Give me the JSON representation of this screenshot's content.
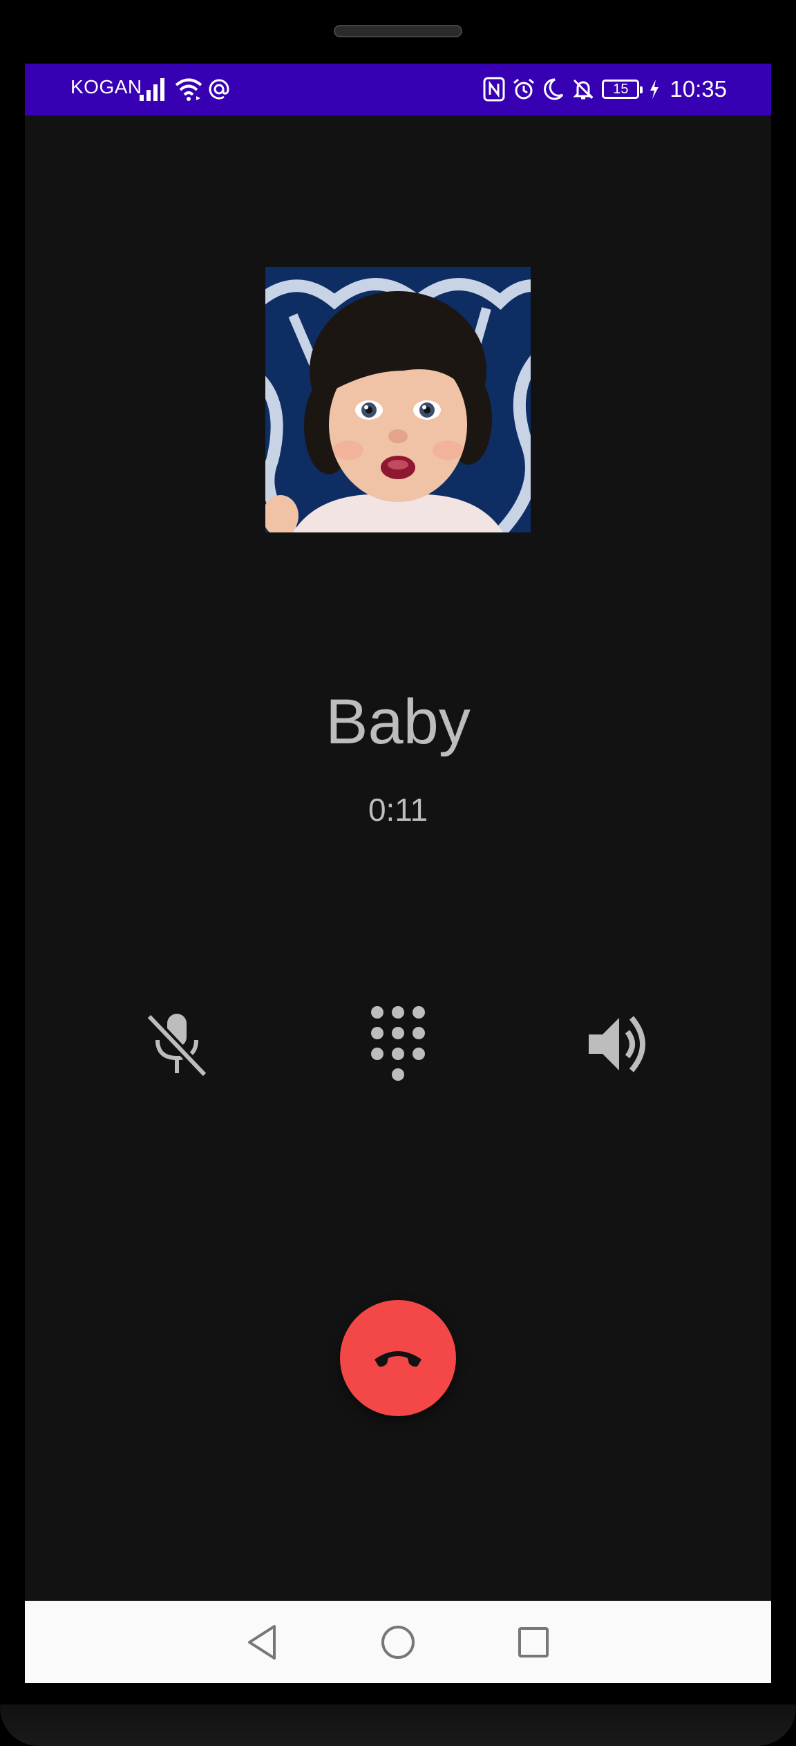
{
  "status_bar": {
    "carrier": "KOGAN",
    "battery_level": "15",
    "time": "10:35",
    "icons": [
      "signal-icon",
      "wifi-icon",
      "at-sign-icon",
      "nfc-icon",
      "alarm-icon",
      "do-not-disturb-moon-icon",
      "notifications-off-icon",
      "battery-icon",
      "charging-bolt-icon"
    ]
  },
  "call": {
    "contact_name": "Baby",
    "duration": "0:11"
  },
  "controls": {
    "mute_icon": "mic-off-icon",
    "dialpad_icon": "dialpad-icon",
    "speaker_icon": "volume-up-icon",
    "end_call_icon": "call-end-icon"
  },
  "navigation": {
    "icons": [
      "back-triangle-icon",
      "home-circle-icon",
      "recents-square-icon"
    ]
  },
  "colors": {
    "status_bar": "#3700b3",
    "background": "#121212",
    "text": "#bdbdbd",
    "end_call": "#f44848"
  }
}
